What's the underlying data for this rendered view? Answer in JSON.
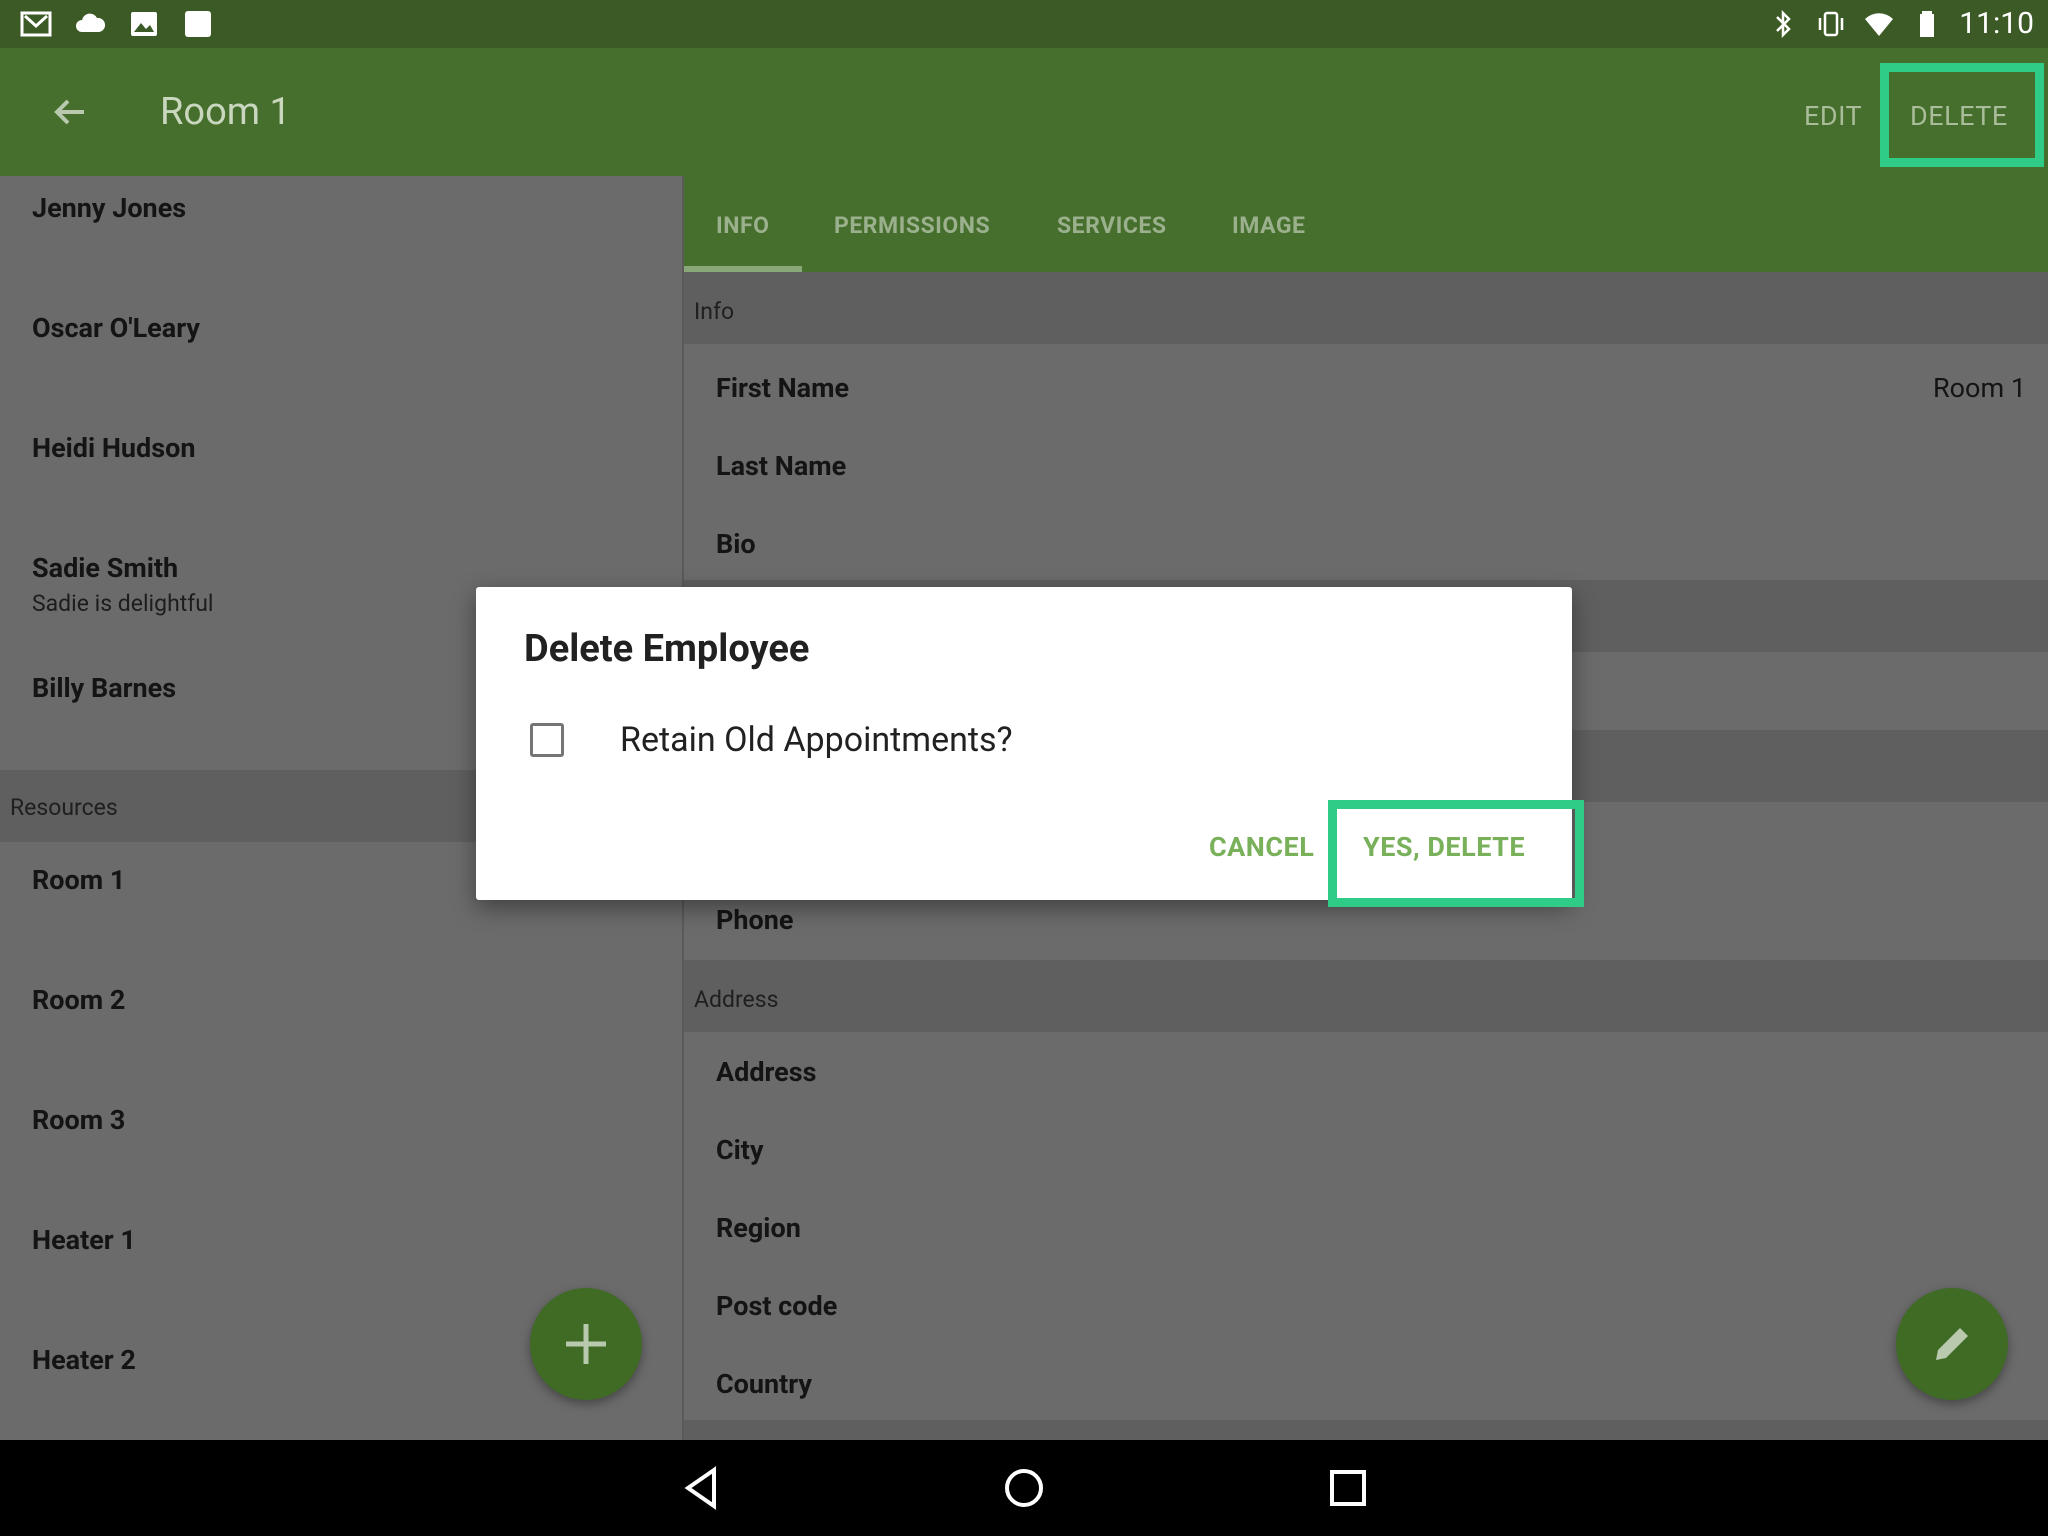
{
  "status_bar": {
    "time": "11:10",
    "left_icons": [
      "gmail-icon",
      "cloud-icon",
      "image-icon",
      "square-icon"
    ],
    "right_icons": [
      "bluetooth-icon",
      "vibrate-icon",
      "wifi-icon",
      "battery-icon"
    ]
  },
  "app_bar": {
    "title": "Room 1",
    "edit_label": "EDIT",
    "delete_label": "DELETE"
  },
  "list": {
    "employees": [
      {
        "name": "Jenny Jones",
        "subtitle": ""
      },
      {
        "name": "Oscar O'Leary",
        "subtitle": ""
      },
      {
        "name": "Heidi Hudson",
        "subtitle": ""
      },
      {
        "name": "Sadie Smith",
        "subtitle": "Sadie is delightful"
      },
      {
        "name": "Billy Barnes",
        "subtitle": ""
      }
    ],
    "resources_header": "Resources",
    "resources": [
      {
        "name": "Room 1"
      },
      {
        "name": "Room 2"
      },
      {
        "name": "Room 3"
      },
      {
        "name": "Heater 1"
      },
      {
        "name": "Heater 2"
      }
    ]
  },
  "tabs": [
    "INFO",
    "PERMISSIONS",
    "SERVICES",
    "IMAGE"
  ],
  "detail": {
    "info_header": "Info",
    "first_name_label": "First Name",
    "first_name_value": "Room 1",
    "last_name_label": "Last Name",
    "bio_label": "Bio",
    "phone_label": "Phone",
    "address_header": "Address",
    "address_label": "Address",
    "city_label": "City",
    "region_label": "Region",
    "post_code_label": "Post code",
    "country_label": "Country"
  },
  "dialog": {
    "title": "Delete Employee",
    "checkbox_label": "Retain Old Appointments?",
    "checkbox_checked": false,
    "cancel_label": "CANCEL",
    "confirm_label": "YES, DELETE"
  },
  "colors": {
    "status_bar": "#3b5a26",
    "app_bar": "#466e2d",
    "accent_button": "#79b05a",
    "highlight": "#2ecc87",
    "fab": "#3f6b25"
  }
}
